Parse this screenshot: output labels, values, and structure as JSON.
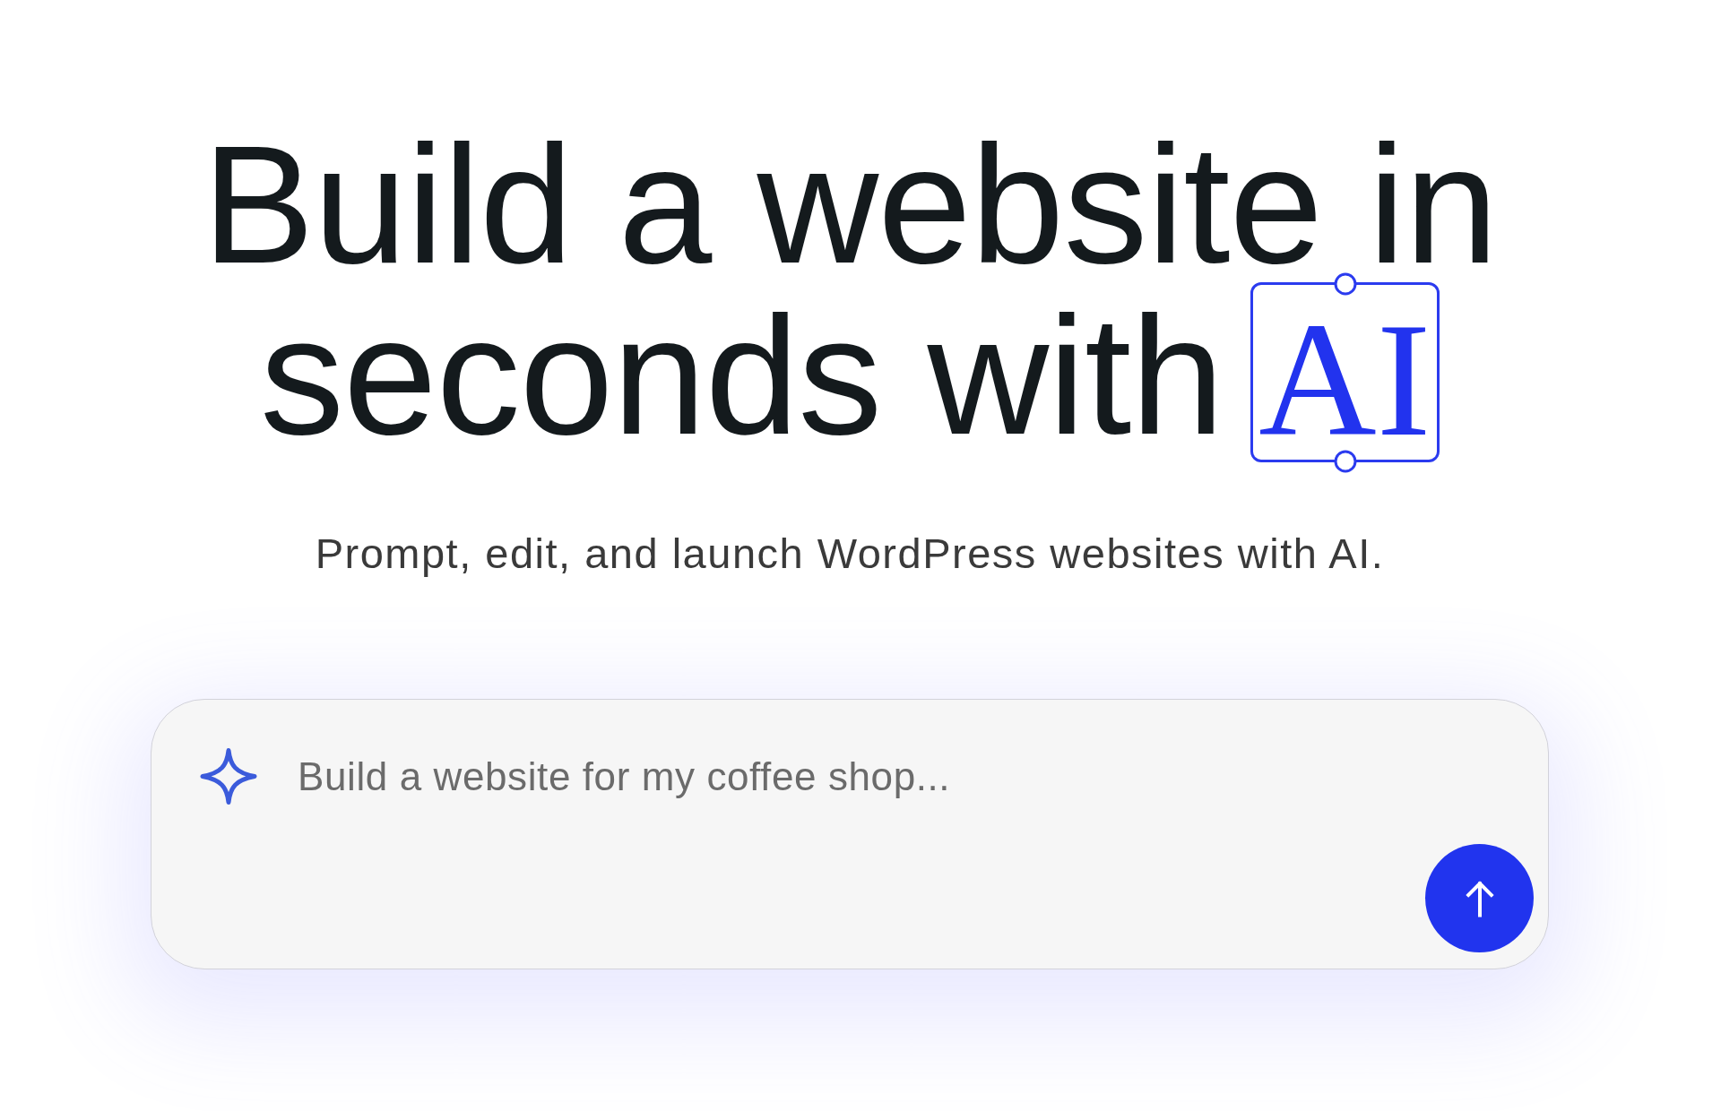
{
  "headline": {
    "lines": [
      "Build a website in",
      "seconds with"
    ],
    "highlight": "AI"
  },
  "subtitle": "Prompt, edit, and launch WordPress websites with AI.",
  "prompt": {
    "placeholder": "Build a website for my coffee shop..."
  }
}
